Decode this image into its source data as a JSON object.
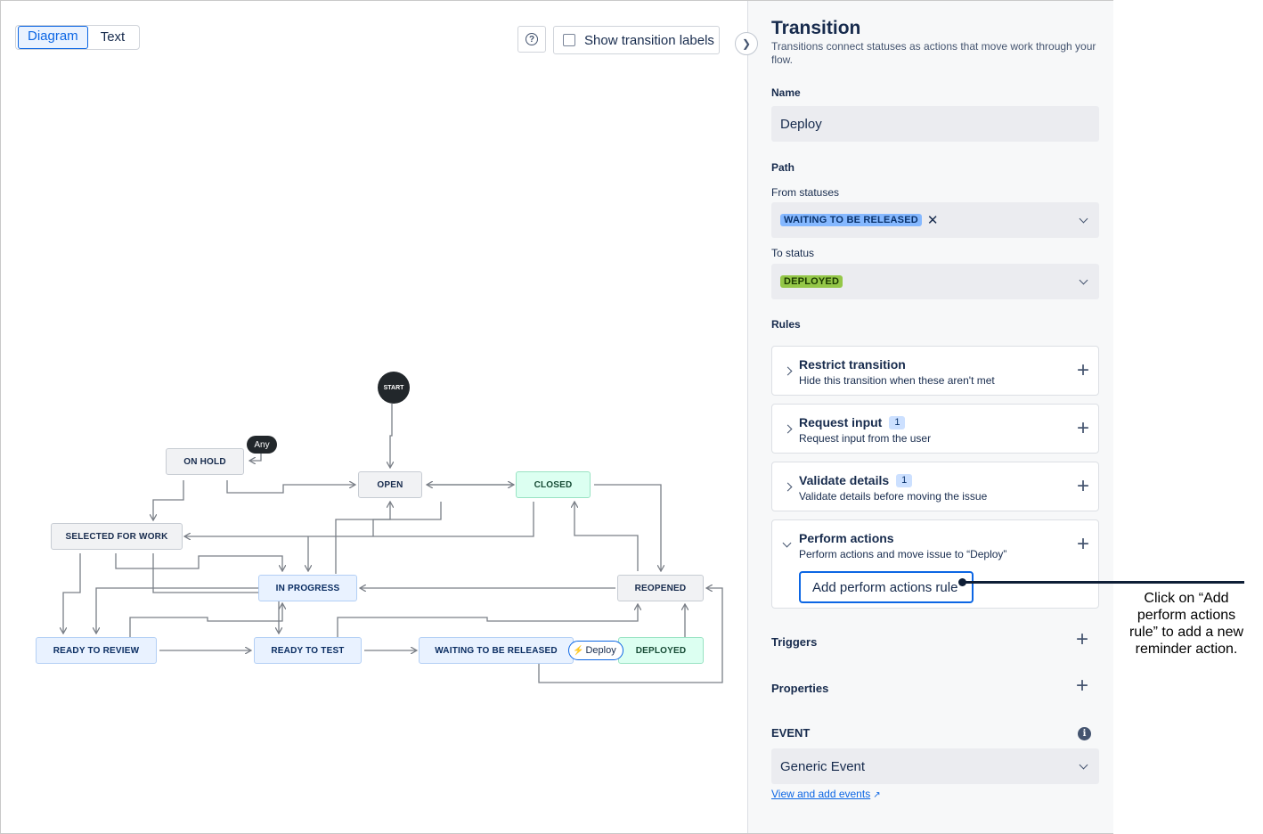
{
  "canvas": {
    "view_toggle": {
      "diagram": "Diagram",
      "text": "Text",
      "active": "Diagram"
    },
    "help_icon": "?",
    "show_labels": {
      "label": "Show transition labels",
      "checked": false
    },
    "nodes": {
      "start": "START",
      "any": "Any",
      "on_hold": "ON HOLD",
      "open": "OPEN",
      "closed": "CLOSED",
      "selected_for_work": "SELECTED FOR WORK",
      "in_progress": "IN PROGRESS",
      "reopened": "REOPENED",
      "ready_to_review": "READY TO REVIEW",
      "ready_to_test": "READY TO TEST",
      "waiting_to_be_released": "WAITING TO BE RELEASED",
      "deployed": "DEPLOYED"
    },
    "transition_chip": {
      "icon": "lightning-icon",
      "label": "Deploy"
    }
  },
  "panel": {
    "title": "Transition",
    "description": "Transitions connect statuses as actions that move work through your flow.",
    "name": {
      "label": "Name",
      "value": "Deploy"
    },
    "path": {
      "label": "Path",
      "from_label": "From statuses",
      "from_value": "WAITING TO BE RELEASED",
      "to_label": "To status",
      "to_value": "DEPLOYED"
    },
    "rules": {
      "label": "Rules",
      "items": [
        {
          "title": "Restrict transition",
          "subtitle": "Hide this transition when these aren't met",
          "count": ""
        },
        {
          "title": "Request input",
          "subtitle": "Request input from the user",
          "count": "1"
        },
        {
          "title": "Validate details",
          "subtitle": "Validate details before moving the issue",
          "count": "1"
        },
        {
          "title": "Perform actions",
          "subtitle": "Perform actions and move issue to “Deploy”",
          "count": ""
        }
      ],
      "add_button": "Add perform actions rule"
    },
    "triggers": "Triggers",
    "properties": "Properties",
    "event": {
      "label": "EVENT",
      "value": "Generic Event"
    },
    "link": "View and add events"
  },
  "annotation": "Click on “Add perform actions rule” to add a new reminder action.",
  "colors": {
    "accent": "#0c66e4",
    "blue_lozenge": "#85b8ff",
    "green_lozenge": "#94c748",
    "callout": "#0e1e36"
  }
}
